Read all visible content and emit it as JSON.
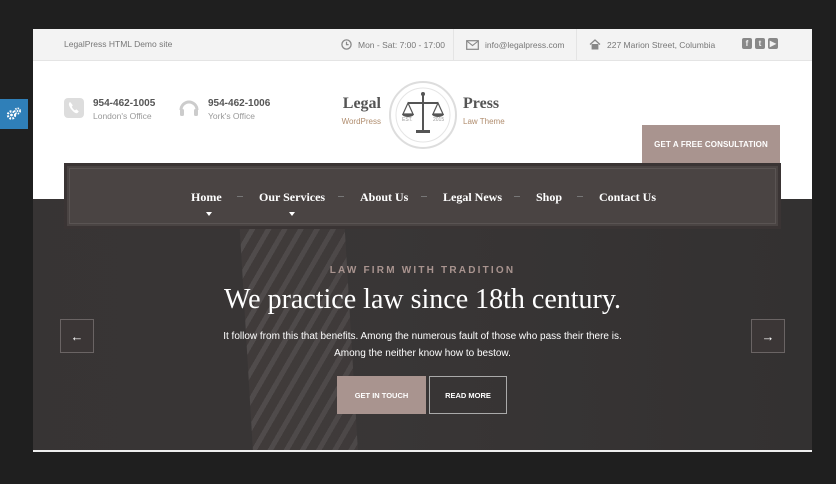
{
  "topbar": {
    "site_title": "LegalPress HTML Demo site",
    "hours": "Mon - Sat: 7:00 - 17:00",
    "email": "info@legalpress.com",
    "address": "227 Marion Street, Columbia",
    "social_icons": [
      "facebook-icon",
      "twitter-icon",
      "youtube-icon"
    ]
  },
  "header": {
    "phones": [
      {
        "number": "954-462-1005",
        "label": "London's Office"
      },
      {
        "number": "954-462-1006",
        "label": "York's Office"
      }
    ],
    "logo": {
      "left_word": "Legal",
      "right_word": "Press",
      "left_sub": "WordPress",
      "right_sub": "Law Theme",
      "est": "EST.",
      "year": "2015"
    },
    "cta_label": "GET A FREE CONSULTATION"
  },
  "nav": {
    "items": [
      "Home",
      "Our Services",
      "About Us",
      "Legal News",
      "Shop",
      "Contact Us"
    ],
    "separator": "–"
  },
  "hero": {
    "kicker": "LAW FIRM WITH TRADITION",
    "headline": "We practice law since 18th century.",
    "desc_line1": "It follow from this that benefits. Among the numerous fault of those who pass their there is.",
    "desc_line2": "Among the neither know how to bestow.",
    "button_primary": "GET IN TOUCH",
    "button_secondary": "READ MORE",
    "prev": "←",
    "next": "→"
  },
  "colors": {
    "accent": "#a9948f",
    "dark": "#3b3838",
    "nav_bg": "#4a4443",
    "gold": "#b08d6e",
    "settings_tab": "#2f7fb8"
  }
}
